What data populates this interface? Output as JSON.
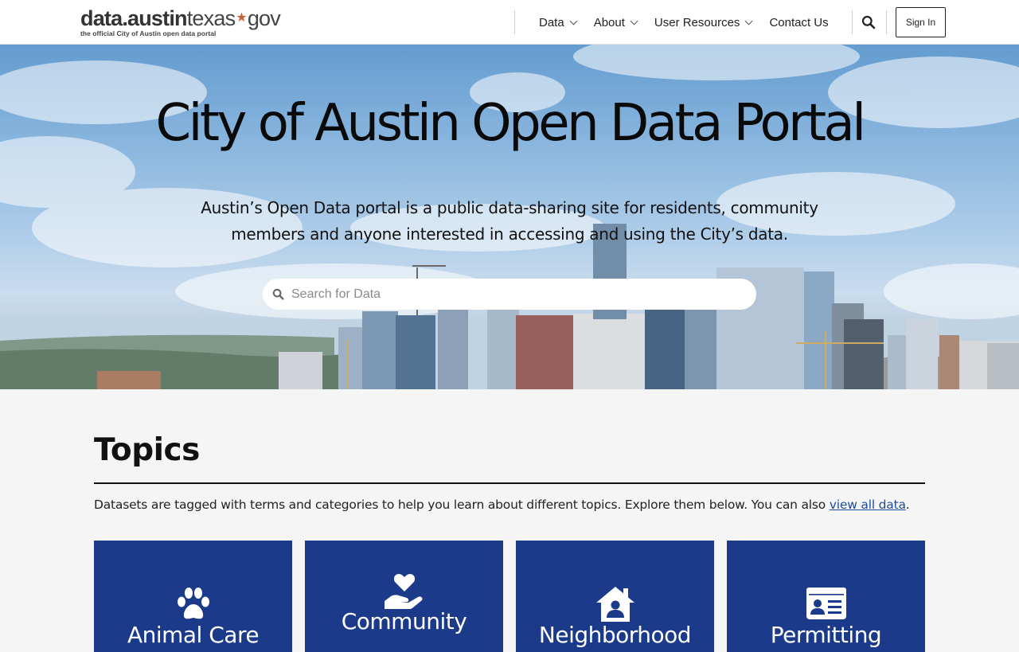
{
  "header": {
    "logo_bold": "data.austin",
    "logo_light": "texas",
    "logo_gov": "gov",
    "logo_tagline": "the official City of Austin open data portal",
    "nav": [
      {
        "label": "Data",
        "has_dropdown": true
      },
      {
        "label": "About",
        "has_dropdown": true
      },
      {
        "label": "User Resources",
        "has_dropdown": true
      },
      {
        "label": "Contact Us",
        "has_dropdown": false
      }
    ],
    "search_icon": "search-icon",
    "sign_in_label": "Sign In"
  },
  "hero": {
    "title": "City of Austin Open Data Portal",
    "subtitle": "Austin’s Open Data portal is a public data-sharing site for residents, community members and anyone interested in accessing and using the City’s data.",
    "search_placeholder": "Search for Data"
  },
  "topics": {
    "heading": "Topics",
    "description_prefix": "Datasets are tagged with terms and categories to help you learn about different topics. Explore them below. You can also ",
    "view_all_link": "view all data",
    "description_suffix": ".",
    "cards": [
      {
        "label": "Animal Care",
        "icon": "paw-icon"
      },
      {
        "label": "Community",
        "icon": "heart-hand-icon"
      },
      {
        "label": "Neighborhood",
        "icon": "house-person-icon"
      },
      {
        "label": "Permitting",
        "icon": "id-card-icon"
      }
    ]
  },
  "colors": {
    "card_blue": "#1b3a8a",
    "link_blue": "#1d4e9c",
    "logo_star": "#c9603a"
  }
}
